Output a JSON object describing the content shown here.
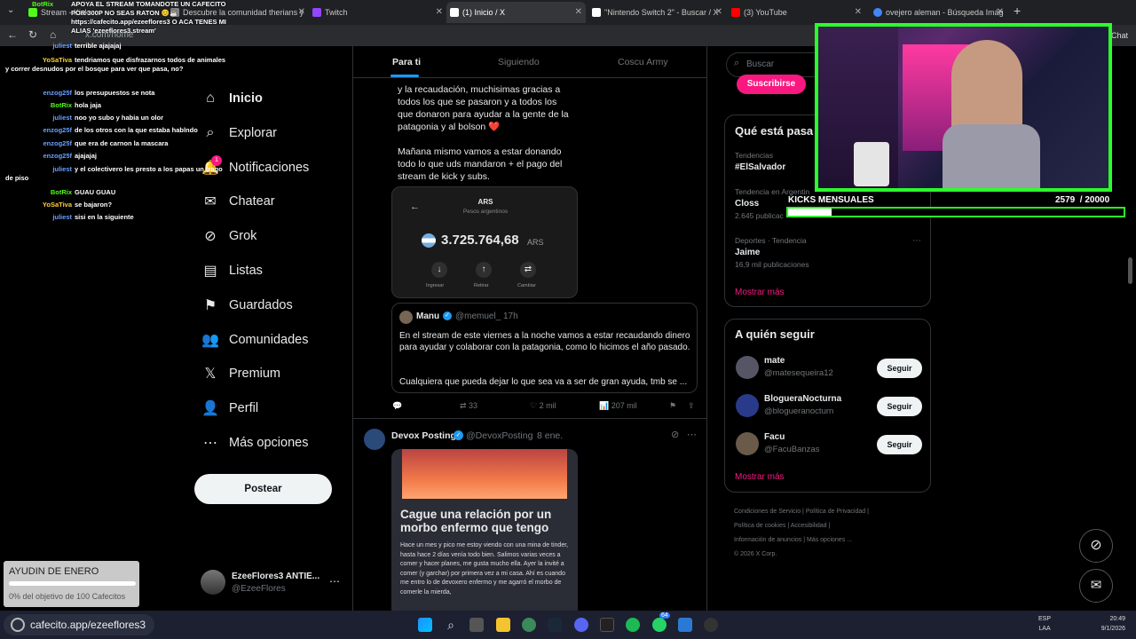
{
  "browser": {
    "tabs": [
      {
        "label": "Stream - Kick",
        "icon_color": "#53fc18"
      },
      {
        "label": "Descubre la comunidad therians y",
        "icon_color": "#888"
      },
      {
        "label": "Twitch",
        "icon_color": "#9146ff"
      },
      {
        "label": "(1) Inicio / X",
        "icon_color": "#ffffff"
      },
      {
        "label": "\"Nintendo Switch 2\" - Buscar / X",
        "icon_color": "#ffffff"
      },
      {
        "label": "(3) YouTube",
        "icon_color": "#ff0000"
      },
      {
        "label": "ovejero aleman - Búsqueda Imág",
        "icon_color": "#4285f4"
      }
    ],
    "address": "x.com/home",
    "chat_button": "Chat"
  },
  "chat_overlay": {
    "pinned": "APOYA EL STREAM TOMANDOTE UN CAFECITO POR 300P NO SEAS RATON 😊☕ https://cafecito.app/ezeeflores3 O ACA TENES MI ALIAS 'ezeeflores3.stream'",
    "messages": [
      {
        "user": "BotRix",
        "text": "",
        "color": "#53fc18"
      },
      {
        "user": "juliest",
        "text": "terrible ajajajaj",
        "color": "#6aa0ff"
      },
      {
        "user": "YoSaTiva",
        "text": "tendriamos que disfrazarnos todos de animales y correr desnudos por el bosque para ver que pasa, no?",
        "color": "#ffd23f"
      },
      {
        "user": "enzog25f",
        "text": "los presupuestos se nota",
        "color": "#6aa0ff"
      },
      {
        "user": "BotRix",
        "text": "hola jaja",
        "color": "#53fc18"
      },
      {
        "user": "juliest",
        "text": "noo yo subo y habia un olor",
        "color": "#6aa0ff"
      },
      {
        "user": "enzog25f",
        "text": "de los otros con la que estaba hablndo",
        "color": "#6aa0ff"
      },
      {
        "user": "enzog25f",
        "text": "que era de carnon la mascara",
        "color": "#6aa0ff"
      },
      {
        "user": "enzog25f",
        "text": "ajajajaj",
        "color": "#6aa0ff"
      },
      {
        "user": "juliest",
        "text": "y el colectivero les presto a los papas un trago de piso",
        "color": "#6aa0ff"
      },
      {
        "user": "BotRix",
        "text": "GUAU GUAU",
        "color": "#53fc18"
      },
      {
        "user": "YoSaTiva",
        "text": "se bajaron?",
        "color": "#ffd23f"
      },
      {
        "user": "juliest",
        "text": "sisi en la siguiente",
        "color": "#6aa0ff"
      }
    ]
  },
  "nav": {
    "items": [
      {
        "label": "Inicio",
        "icon": "home-icon",
        "glyph": "⌂"
      },
      {
        "label": "Explorar",
        "icon": "search-icon",
        "glyph": "⌕"
      },
      {
        "label": "Notificaciones",
        "icon": "bell-icon",
        "glyph": "🔔"
      },
      {
        "label": "Chatear",
        "icon": "mail-icon",
        "glyph": "✉"
      },
      {
        "label": "Grok",
        "icon": "grok-icon",
        "glyph": "⊘"
      },
      {
        "label": "Listas",
        "icon": "list-icon",
        "glyph": "▤"
      },
      {
        "label": "Guardados",
        "icon": "bookmark-icon",
        "glyph": "⚑"
      },
      {
        "label": "Comunidades",
        "icon": "people-icon",
        "glyph": "👥"
      },
      {
        "label": "Premium",
        "icon": "x-logo-icon",
        "glyph": "𝕏"
      },
      {
        "label": "Perfil",
        "icon": "person-icon",
        "glyph": "👤"
      },
      {
        "label": "Más opciones",
        "icon": "more-icon",
        "glyph": "⋯"
      }
    ],
    "notif_badge": "1",
    "post_label": "Postear",
    "account_name": "EzeeFlores3 ANTIE...",
    "account_handle": "@EzeeFlores"
  },
  "feed": {
    "tabs": [
      "Para ti",
      "Siguiendo",
      "Coscu Army"
    ],
    "tweet1_text": "y la recaudación, muchisimas gracias a todos los que se pasaron y a todos los que donaron para ayudar a la gente de la patagonia y al bolson ❤️\n\nMañana mismo vamos a estar donando todo lo que uds mandaron + el pago del stream de kick y subs.",
    "wallet": {
      "currency": "ARS",
      "currency_name": "Pesos argentinos",
      "amount": "3.725.764,68",
      "suffix": "ARS",
      "actions": [
        "Ingresar",
        "Retirar",
        "Cambiar"
      ]
    },
    "quote": {
      "name": "Manu",
      "handle": "@memuel_",
      "time": "17h",
      "text": "En el stream de este viernes a la noche vamos a estar recaudando dinero para ayudar y colaborar con la patagonia, como lo hicimos el año pasado.",
      "text2": "Cualquiera que pueda dejar lo que sea va a ser de gran ayuda, tmb se ..."
    },
    "stats": {
      "retweets": "33",
      "likes": "2 mil",
      "views": "207 mil"
    },
    "tweet2": {
      "name": "Devox Posting",
      "handle": "@DevoxPosting",
      "time": "8 ene.",
      "headline": "Cague una relación por un morbo enfermo que tengo",
      "body": "Hace un mes y pico me estoy viendo con una mina de tinder, hasta hace 2 días venía todo bien. Salimos varias veces a comer y hacer planes, me gusta mucho ella. Ayer la invité a comer (y garchar) por primera vez a mi casa. Ahí es cuando me entro lo de devoxero enfermo y me agarró el morbo de comerle la mierda,"
    }
  },
  "right": {
    "search_placeholder": "Buscar",
    "subscribe_label": "Suscribirse",
    "trends_title": "Qué está pasa",
    "trends": [
      {
        "context": "Tendencias",
        "name": "#ElSalvador",
        "posts": ""
      },
      {
        "context": "Tendencia en Argentin",
        "name": "Closs",
        "posts": "2.645 publicac"
      },
      {
        "context": "Deportes · Tendencia",
        "name": "Jaime",
        "posts": "16,9 mil publicaciones"
      }
    ],
    "show_more": "Mostrar más",
    "follow_title": "A quién seguir",
    "suggestions": [
      {
        "name": "mate",
        "handle": "@matesequeira12",
        "avatar_color": "#556"
      },
      {
        "name": "BlogueraNocturna",
        "handle": "@blogueranocturn",
        "avatar_color": "#2a3a8a"
      },
      {
        "name": "Facu",
        "handle": "@FacuBanzas",
        "avatar_color": "#6a5a4a"
      }
    ],
    "follow_label": "Seguir",
    "footer": [
      "Condiciones de Servicio",
      "Política de Privacidad",
      "Política de cookies",
      "Accesibilidad",
      "Información de anuncios",
      "Más opciones ...",
      "© 2026 X Corp."
    ]
  },
  "overlays": {
    "kicks_label": "KICKS MENSUALES",
    "kicks_value": "2579  / 20000",
    "kicks_progress": 0.129,
    "goal_title": "AYUDIN DE ENERO",
    "goal_text": "0% del objetivo de 100 Cafecitos",
    "cafecito_url": "cafecito.app/ezeeflores3"
  },
  "taskbar": {
    "lang": "ESP",
    "layout": "LAA",
    "time": "20:49",
    "date": "9/1/2026",
    "badge": "64"
  }
}
